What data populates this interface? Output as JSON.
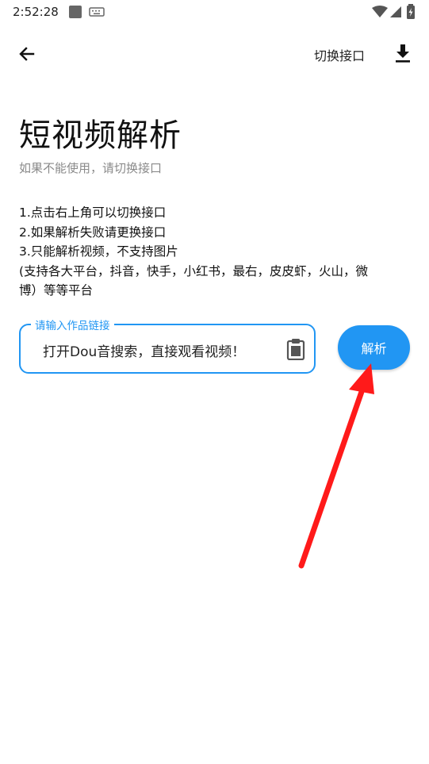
{
  "status_bar": {
    "time": "2:52:28"
  },
  "app_bar": {
    "back_icon": "arrow-left-icon",
    "switch_label": "切换接口",
    "download_icon": "download-icon"
  },
  "header": {
    "title": "短视频解析",
    "subtitle": "如果不能使用，请切换接口"
  },
  "instructions": [
    "1.点击右上角可以切换接口",
    "2.如果解析失败请更换接口",
    "3.只能解析视频，不支持图片",
    "(支持各大平台，抖音，快手，小红书，最右，皮皮虾，火山，微",
    "博）等等平台"
  ],
  "link_input": {
    "label": "请输入作品链接",
    "value": "打开Dou音搜索，直接观看视频！",
    "paste_icon": "clipboard-icon"
  },
  "parse_button": {
    "label": "解析"
  },
  "colors": {
    "accent": "#2196f3",
    "annotation_arrow": "#ff1a1a"
  }
}
